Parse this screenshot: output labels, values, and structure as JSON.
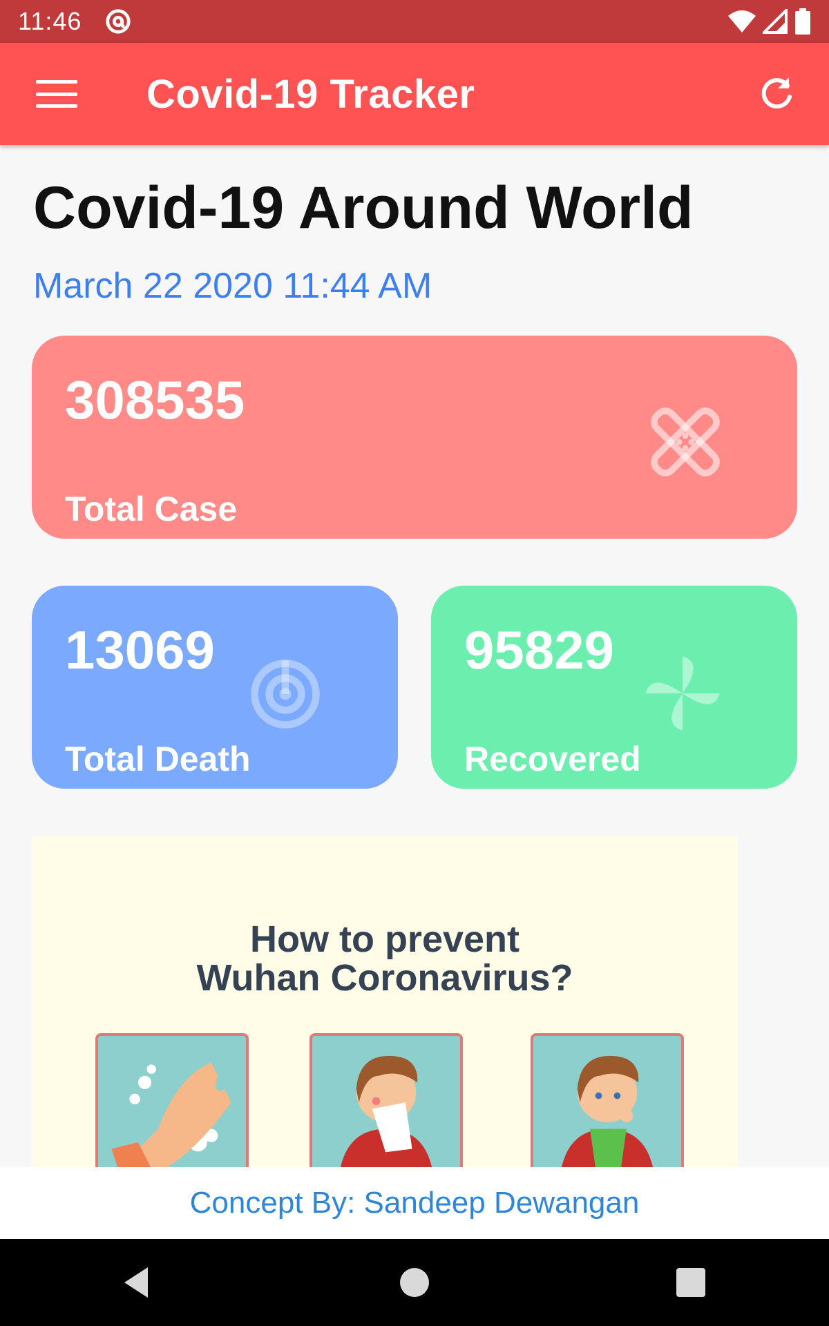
{
  "status_bar": {
    "time": "11:46",
    "icons": [
      "at-sign-icon",
      "wifi-icon",
      "signal-icon",
      "battery-icon"
    ]
  },
  "app_bar": {
    "title": "Covid-19 Tracker",
    "menu_icon": "hamburger-menu-icon",
    "refresh_icon": "refresh-icon",
    "background": "#ff5252"
  },
  "header": {
    "title": "Covid-19 Around World",
    "updated": "March 22 2020 11:44 AM"
  },
  "stats": {
    "total_case": {
      "value": "308535",
      "label": "Total Case",
      "color": "#ff8a87",
      "icon": "bandage-icon"
    },
    "total_death": {
      "value": "13069",
      "label": "Total Death",
      "color": "#7aa9fd",
      "icon": "radar-icon"
    },
    "recovered": {
      "value": "95829",
      "label": "Recovered",
      "color": "#6beeae",
      "icon": "pinwheel-icon"
    }
  },
  "banner": {
    "title_line1": "How to prevent",
    "title_line2": "Wuhan Coronavirus?",
    "tiles": [
      "hand-washing-illustration",
      "sneezing-illustration",
      "coughing-illustration"
    ]
  },
  "footer": {
    "credit": "Concept By: Sandeep Dewangan",
    "color": "#2f86d8"
  },
  "nav_bar": {
    "buttons": [
      "back-icon",
      "home-icon",
      "recents-icon"
    ]
  }
}
